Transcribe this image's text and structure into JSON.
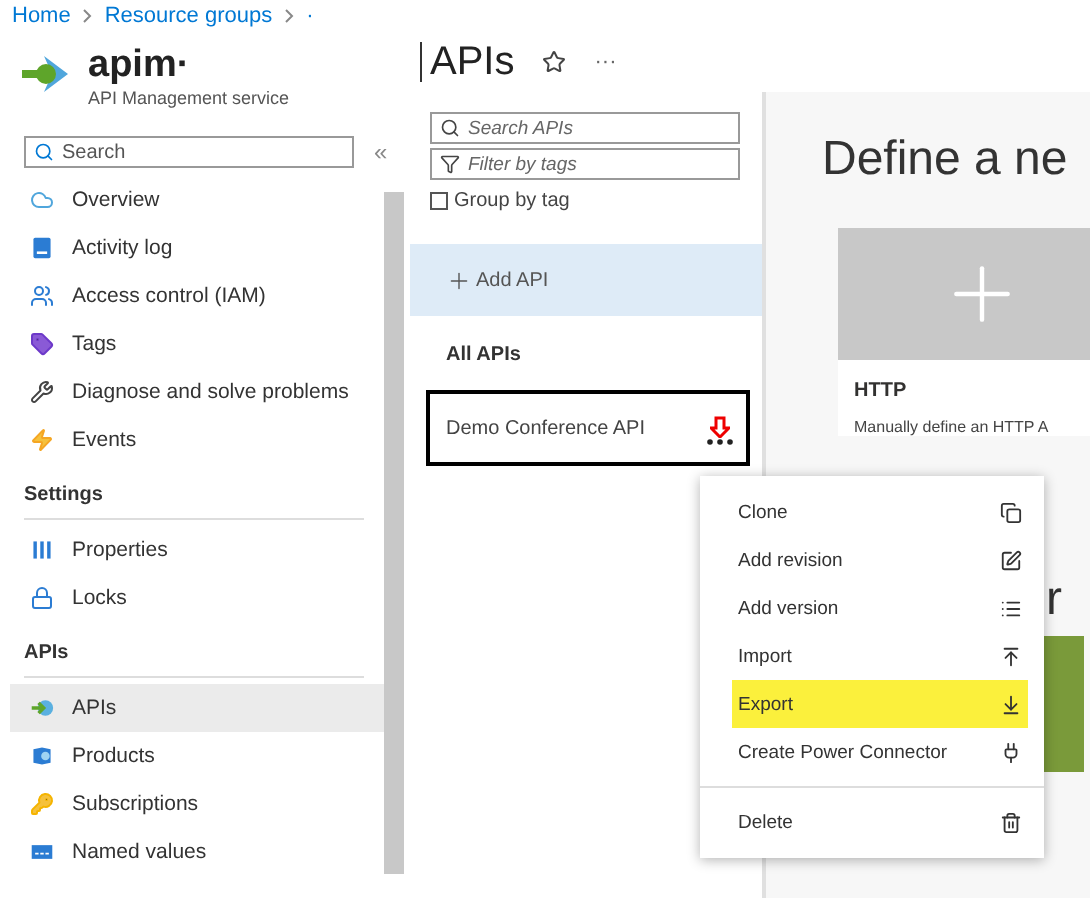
{
  "breadcrumb": [
    "Home",
    "Resource groups",
    "·"
  ],
  "service": {
    "name": "apim·",
    "subtitle": "API Management service"
  },
  "sidebar": {
    "search": {
      "placeholder": "Search"
    },
    "collapse": "«",
    "sections": [
      {
        "items": [
          {
            "label": "Overview",
            "selected": false
          },
          {
            "label": "Activity log",
            "selected": false
          },
          {
            "label": "Access control (IAM)",
            "selected": false
          },
          {
            "label": "Tags",
            "selected": false
          },
          {
            "label": "Diagnose and solve problems",
            "selected": false
          },
          {
            "label": "Events",
            "selected": false
          }
        ]
      },
      {
        "title": "Settings",
        "items": [
          {
            "label": "Properties",
            "selected": false
          },
          {
            "label": "Locks",
            "selected": false
          }
        ]
      },
      {
        "title": "APIs",
        "items": [
          {
            "label": "APIs",
            "selected": true
          },
          {
            "label": "Products",
            "selected": false
          },
          {
            "label": "Subscriptions",
            "selected": false
          },
          {
            "label": "Named values",
            "selected": false
          }
        ]
      }
    ]
  },
  "page": {
    "title": "APIs",
    "more": "···"
  },
  "api_list": {
    "search": {
      "placeholder": "Search APIs"
    },
    "filter": {
      "placeholder": "Filter by tags"
    },
    "group_by_tag": {
      "label": "Group by tag",
      "checked": false
    },
    "add_api": "Add API",
    "heading": "All APIs",
    "apis": [
      {
        "name": "Demo Conference API",
        "selected": true
      }
    ]
  },
  "define": {
    "title": "Define a ne",
    "cards": [
      {
        "title": "HTTP",
        "description": "Manually define an HTTP A"
      }
    ],
    "partial_heading": "r"
  },
  "context_menu": [
    {
      "label": "Clone",
      "highlighted": false
    },
    {
      "label": "Add revision",
      "highlighted": false
    },
    {
      "label": "Add version",
      "highlighted": false
    },
    {
      "label": "Import",
      "highlighted": false
    },
    {
      "label": "Export",
      "highlighted": true
    },
    {
      "label": "Create Power Connector",
      "highlighted": false
    },
    {
      "label": "Delete",
      "highlighted": false
    }
  ]
}
